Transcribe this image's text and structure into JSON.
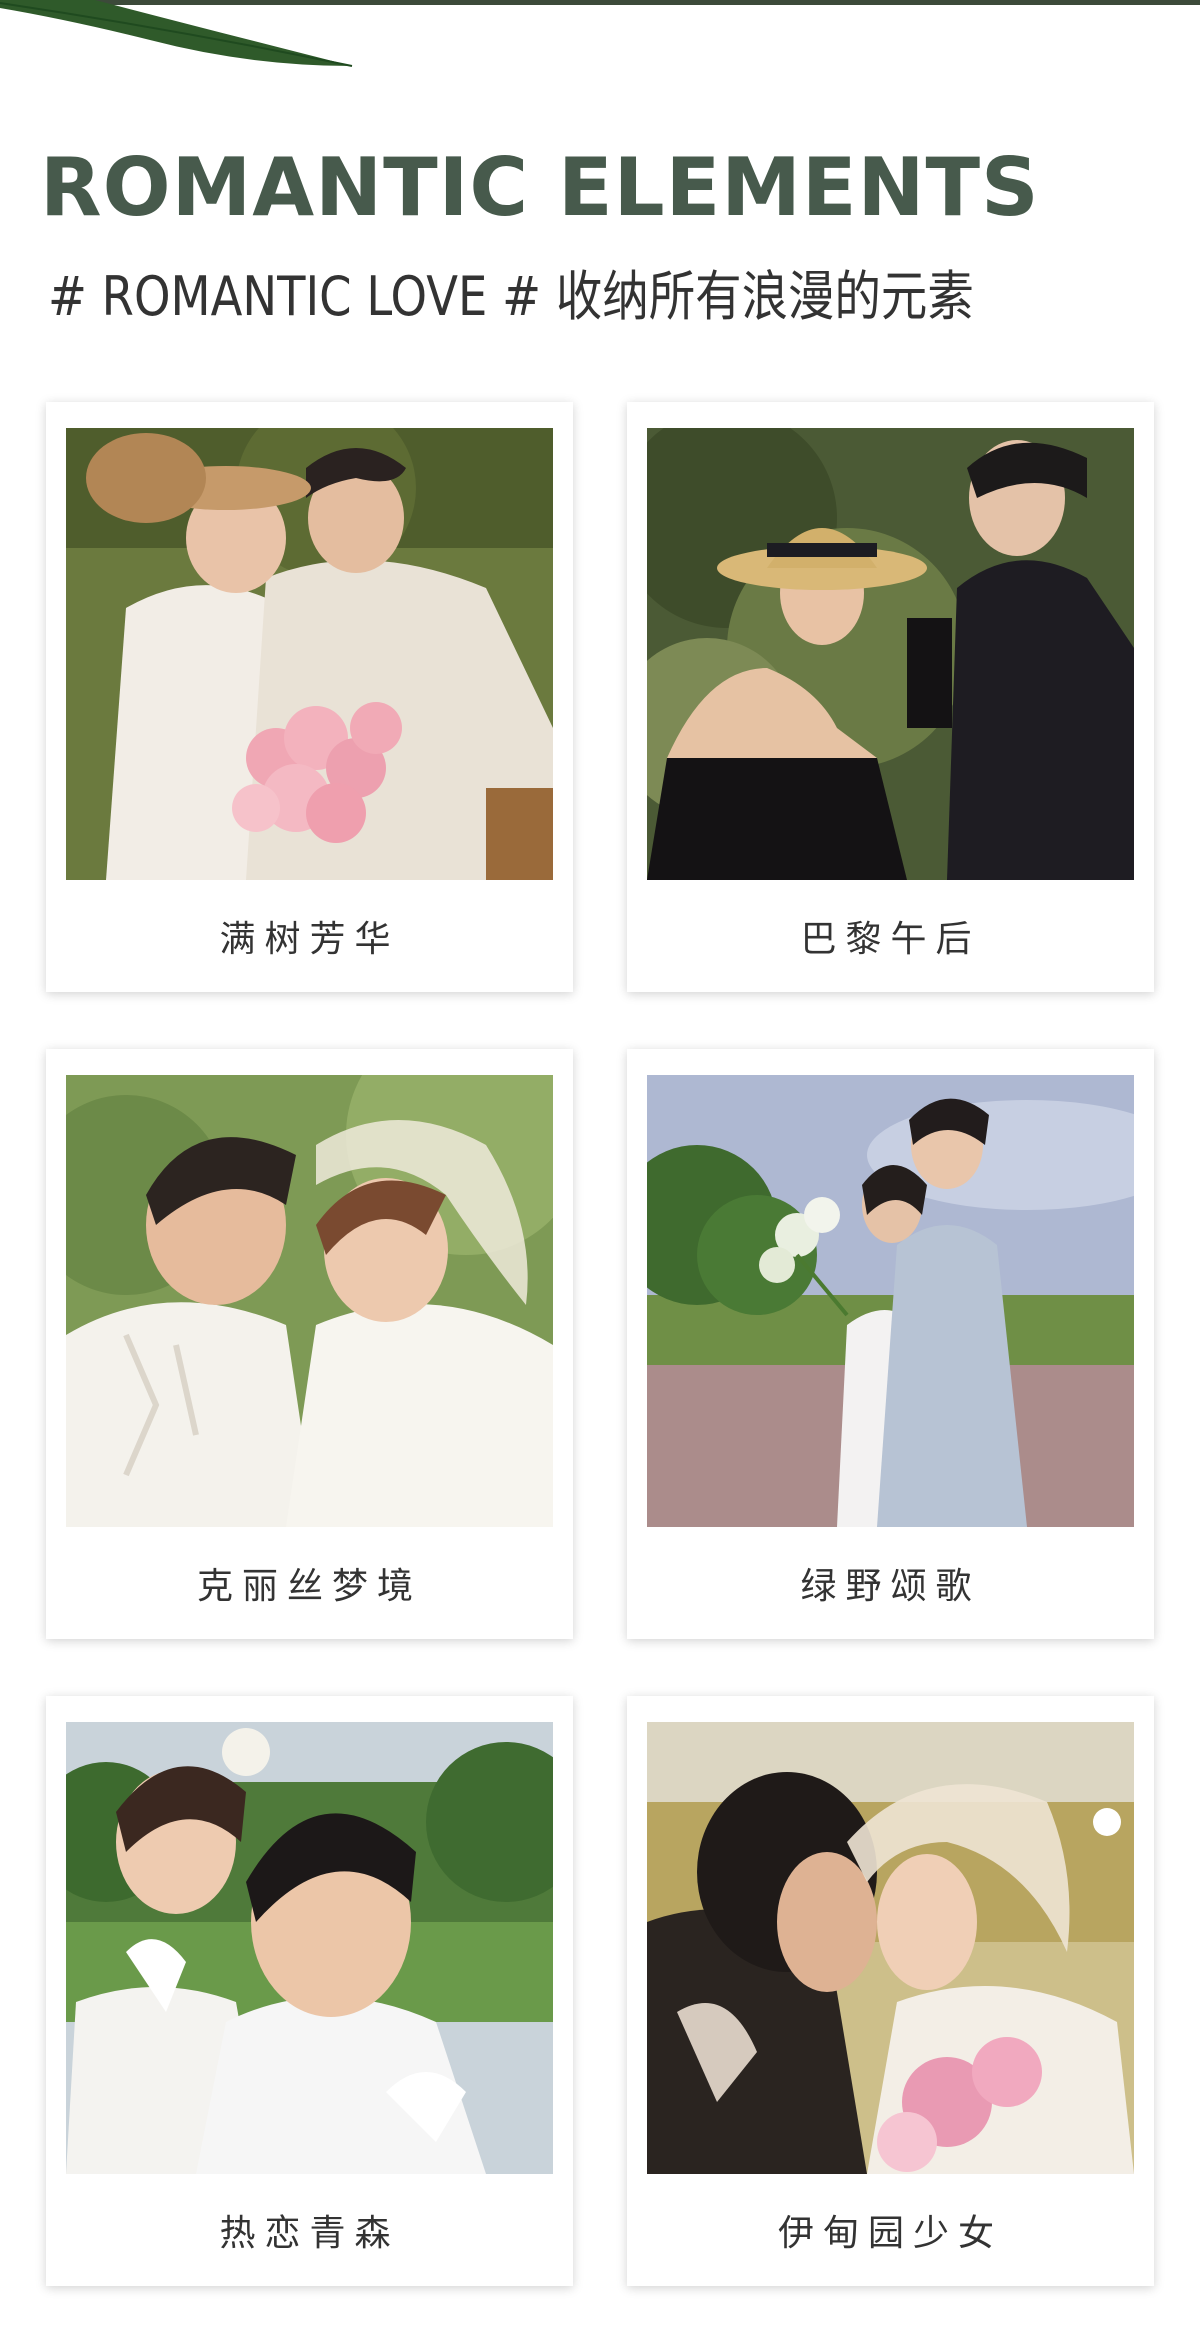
{
  "header": {
    "title": "ROMANTIC ELEMENTS",
    "subtitle": "# ROMANTIC LOVE # 收纳所有浪漫的元素"
  },
  "cards": [
    {
      "caption": "满树芳华",
      "photo_icon": "couple-with-bouquet-photo"
    },
    {
      "caption": "巴黎午后",
      "photo_icon": "couple-in-hat-photo"
    },
    {
      "caption": "克丽丝梦境",
      "photo_icon": "couple-with-veil-photo"
    },
    {
      "caption": "绿野颂歌",
      "photo_icon": "couple-in-field-photo"
    },
    {
      "caption": "热恋青森",
      "photo_icon": "couple-selfie-photo"
    },
    {
      "caption": "伊甸园少女",
      "photo_icon": "couple-kissing-photo"
    }
  ],
  "colors": {
    "title": "#475a4c",
    "subtitle": "#333333",
    "caption": "#333333",
    "card_background": "#ffffff"
  }
}
